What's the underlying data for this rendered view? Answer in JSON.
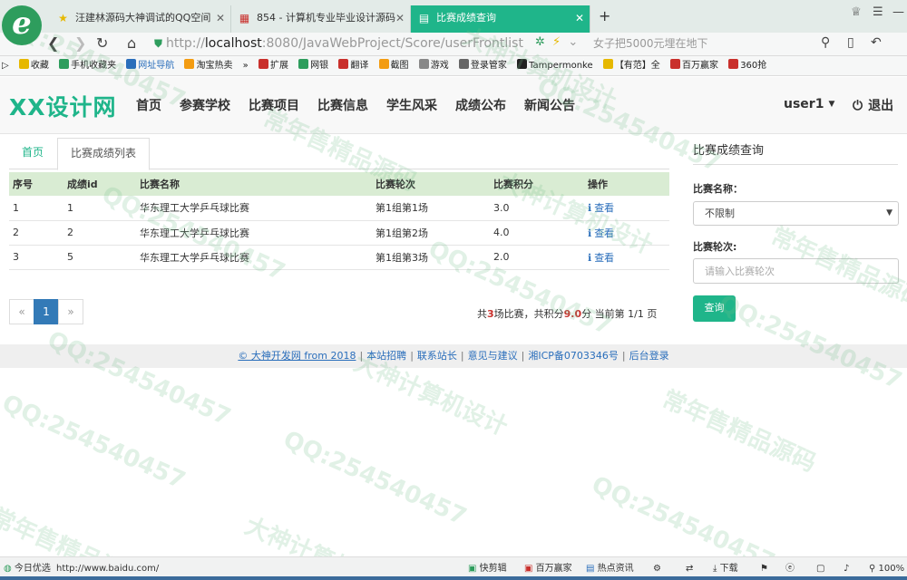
{
  "browser": {
    "logo": "e",
    "tabs": [
      {
        "title": "汪建林源码大神调试的QQ空间",
        "icon": "★",
        "icon_color": "#e6b800"
      },
      {
        "title": "854 - 计算机专业毕业设计源码",
        "icon": "▦",
        "icon_color": "#c9302c"
      },
      {
        "title": "比赛成绩查询",
        "icon": "▤",
        "icon_color": "#ffffff",
        "active": true
      }
    ],
    "new_tab": "+",
    "url_prefix": "http://",
    "url_host": "localhost",
    "url_rest": ":8080/JavaWebProject/Score/userFrontlist",
    "search_placeholder": "女子把5000元埋在地下",
    "favorites": [
      {
        "label": "收藏",
        "color": "#e6b800"
      },
      {
        "label": "手机收藏夹",
        "color": "#2e9d5d"
      },
      {
        "label": "网址导航",
        "color": "#2a6ebb"
      },
      {
        "label": "淘宝热卖",
        "color": "#f39c12"
      },
      {
        "label": "»",
        "color": ""
      },
      {
        "label": "扩展",
        "color": "#c9302c"
      },
      {
        "label": "网银",
        "color": "#2e9d5d"
      },
      {
        "label": "翻译",
        "color": "#c9302c"
      },
      {
        "label": "截图",
        "color": "#f39c12"
      },
      {
        "label": "游戏",
        "color": "#888888"
      },
      {
        "label": "登录管家",
        "color": "#666666"
      },
      {
        "label": "Tampermonke",
        "color": "#222222"
      },
      {
        "label": "【有范】全",
        "color": "#e6b800"
      },
      {
        "label": "百万赢家",
        "color": "#c9302c"
      },
      {
        "label": "360抢",
        "color": "#c9302c"
      }
    ]
  },
  "site": {
    "brand": "XX设计网",
    "menu": [
      "首页",
      "参赛学校",
      "比赛项目",
      "比赛信息",
      "学生风采",
      "成绩公布",
      "新闻公告"
    ],
    "user": "user1",
    "logout": "退出"
  },
  "content": {
    "tabs": [
      "首页",
      "比赛成绩列表"
    ],
    "table": {
      "headers": [
        "序号",
        "成绩id",
        "比赛名称",
        "比赛轮次",
        "比赛积分",
        "操作"
      ],
      "rows": [
        {
          "no": "1",
          "id": "1",
          "name": "华东理工大学乒乓球比赛",
          "round": "第1组第1场",
          "score": "3.0",
          "action": "查看"
        },
        {
          "no": "2",
          "id": "2",
          "name": "华东理工大学乒乓球比赛",
          "round": "第1组第2场",
          "score": "4.0",
          "action": "查看"
        },
        {
          "no": "3",
          "id": "5",
          "name": "华东理工大学乒乓球比赛",
          "round": "第1组第3场",
          "score": "2.0",
          "action": "查看"
        }
      ]
    },
    "pager": {
      "prev": "«",
      "current": "1",
      "next": "»"
    },
    "summary": {
      "p1": "共",
      "count": "3",
      "p2": "场比赛，共积分",
      "total": "9.0",
      "p3": "分 当前第 1/1 页"
    }
  },
  "sidebar": {
    "title": "比赛成绩查询",
    "name_label": "比赛名称：",
    "name_value": "不限制",
    "round_label": "比赛轮次:",
    "round_placeholder": "请输入比赛轮次",
    "query_button": "查询"
  },
  "footer": {
    "copyright": "© 大神开发网 from 2018",
    "links": [
      "本站招聘",
      "联系站长",
      "意见与建议",
      "湘ICP备0703346号",
      "后台登录"
    ]
  },
  "watermark": [
    "常年售精品源码",
    "QQ:254540457",
    "大神计算机设计"
  ],
  "statusbar": {
    "left": "今日优选",
    "url": "http://www.baidu.com/",
    "items": [
      "快剪辑",
      "百万赢家",
      "热点资讯",
      "下载"
    ],
    "zoom": "100%"
  }
}
